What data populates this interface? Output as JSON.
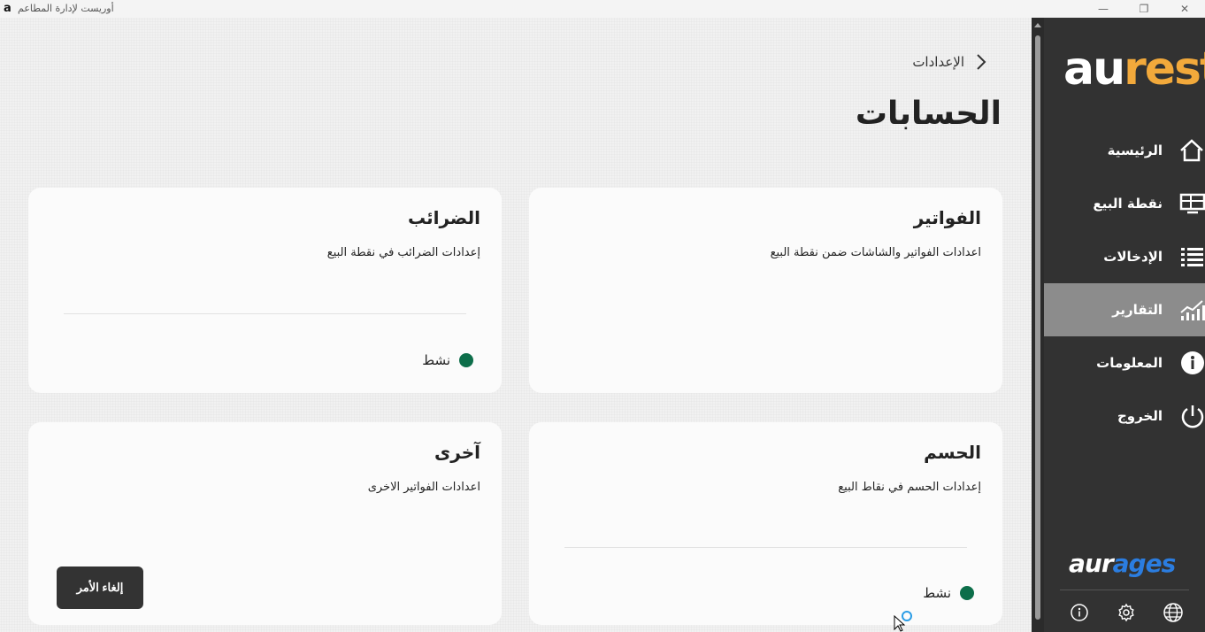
{
  "window": {
    "logo_letter": "a",
    "title": "أوريست لإدارة المطاعم",
    "buttons": [
      "—",
      "❐",
      "✕"
    ]
  },
  "breadcrumb": {
    "label": "الإعدادات",
    "icon": "chevron-right-icon"
  },
  "page": {
    "title": "الحسابات"
  },
  "cards": [
    {
      "title": "الفواتير",
      "description": "اعدادات الفواتير والشاشات ضمن نقطة البيع"
    },
    {
      "title": "الضرائب",
      "description": "إعدادات الضرائب في نقطة البيع",
      "status": "نشط"
    },
    {
      "title": "الحسم",
      "description": "إعدادات الحسم في نقاط البيع",
      "status": "نشط"
    },
    {
      "title": "آخرى",
      "description": "اعدادات الفواتير الاخرى",
      "button": "إلغاء الأمر"
    }
  ],
  "sidebar": {
    "brand": {
      "part1": "au",
      "part2": "rest"
    },
    "items": [
      {
        "label": "الرئيسية",
        "icon": "home-icon",
        "active": false
      },
      {
        "label": "نقطة البيع",
        "icon": "pos-terminal-icon",
        "active": false
      },
      {
        "label": "الإدخالات",
        "icon": "list-icon",
        "active": false
      },
      {
        "label": "التقارير",
        "icon": "chart-icon",
        "active": true
      },
      {
        "label": "المعلومات",
        "icon": "info-icon",
        "active": false
      },
      {
        "label": "الخروج",
        "icon": "power-icon",
        "active": false
      }
    ],
    "footer_brand": {
      "part1": "aur",
      "part2": "ages"
    },
    "footer_icons": [
      "info-icon",
      "gear-icon",
      "globe-icon"
    ]
  },
  "colors": {
    "sidebar_bg": "#323232",
    "active_item": "#8c8c8c",
    "status_green": "#0d6e4a",
    "brand_orange": "#f2a93b",
    "brand_blue": "#2b7de0"
  }
}
